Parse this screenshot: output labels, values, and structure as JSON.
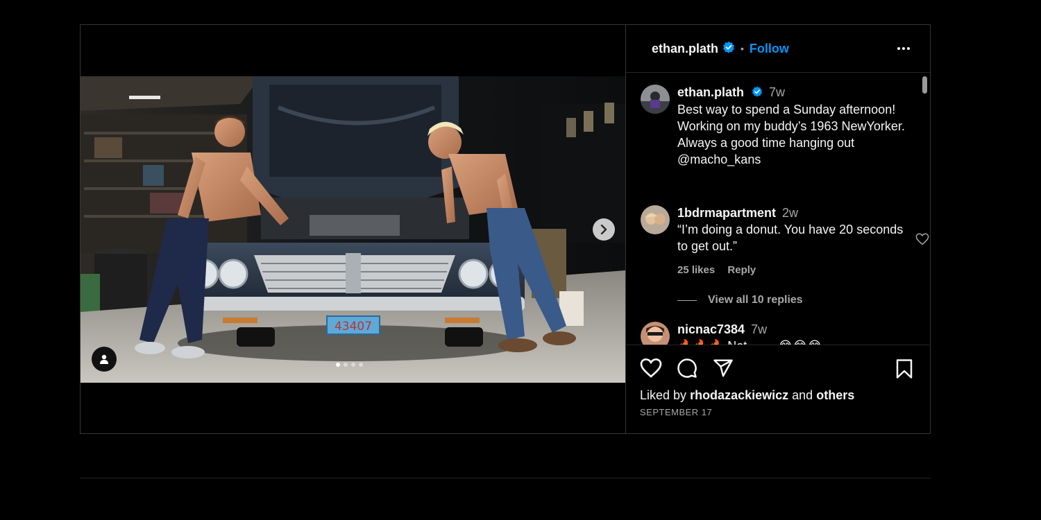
{
  "post": {
    "author": "ethan.plath",
    "follow_label": "Follow",
    "separator": "•",
    "caption_time": "7w",
    "caption": "Best way to spend a Sunday afternoon! Working on my buddy’s 1963 NewYorker. Always a good time hanging out @macho_kans",
    "license_plate": "43407",
    "carousel": {
      "count": 4,
      "active_index": 1
    }
  },
  "comments": [
    {
      "username": "1bdrmapartment",
      "time": "2w",
      "text": "“I’m doing a donut. You have 20 seconds to get out.”",
      "likes": "25 likes",
      "reply_label": "Reply",
      "view_replies": "View all 10 replies"
    },
    {
      "username": "nicnac7384",
      "time": "7w",
      "text": "🔥🔥🔥 Not ....... 😂😂😂"
    }
  ],
  "footer": {
    "liked_by_prefix": "Liked by",
    "liked_by_user": "rhodazackiewicz",
    "liked_by_and": "and",
    "liked_by_others": "others",
    "date": "SEPTEMBER 17"
  },
  "colors": {
    "background": "#000000",
    "accent": "#0095f6",
    "verified": "#0095f6",
    "muted_text": "#a8a8a8",
    "border": "#363636"
  },
  "icons": [
    "verified-badge-icon",
    "more-options-icon",
    "chevron-right-icon",
    "user-tag-icon",
    "heart-icon",
    "comment-icon",
    "share-icon",
    "bookmark-icon"
  ]
}
